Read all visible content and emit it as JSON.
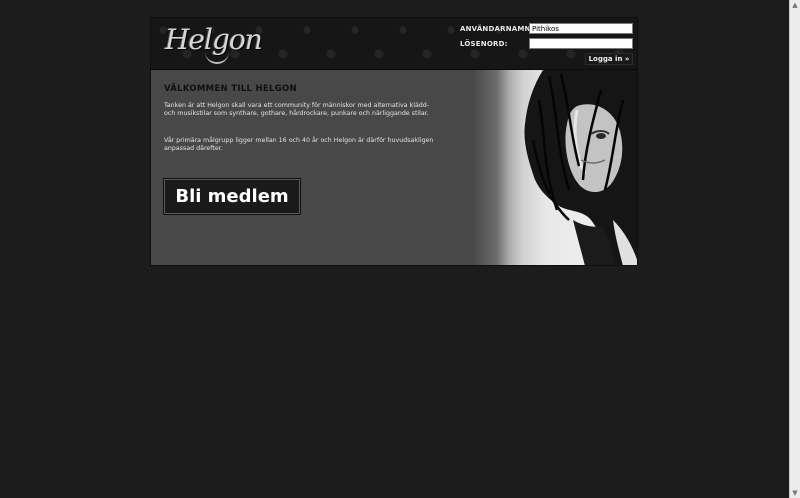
{
  "header": {
    "logo_text": "Helgon",
    "username_label": "ANVÄNDARNAMN:",
    "username_value": "Pithikos",
    "password_label": "LÖSENORD:",
    "password_value": "",
    "login_button": "Logga in »"
  },
  "main": {
    "heading": "VÄLKOMMEN TILL HELGON",
    "intro": "Tanken är att Helgon skall vara ett community för människor med alternativa klädd- och musikstilar som synthare, gothare, hårdrockare, punkare och närliggande stilar.",
    "target": "Vår primära målgrupp ligger mellan 16 och 40 år och Helgon är därför huvudsakligen anpassad därefter.",
    "join_button": "Bli medlem"
  },
  "colors": {
    "page_background": "#1b1c1b",
    "panel_background": "#474847",
    "header_background": "#161616",
    "heading_text": "#0f0f0f",
    "body_text": "#e4e4e4"
  },
  "icons": {
    "scroll_up": "scroll-up-arrow-icon",
    "scroll_down": "scroll-down-arrow-icon"
  }
}
